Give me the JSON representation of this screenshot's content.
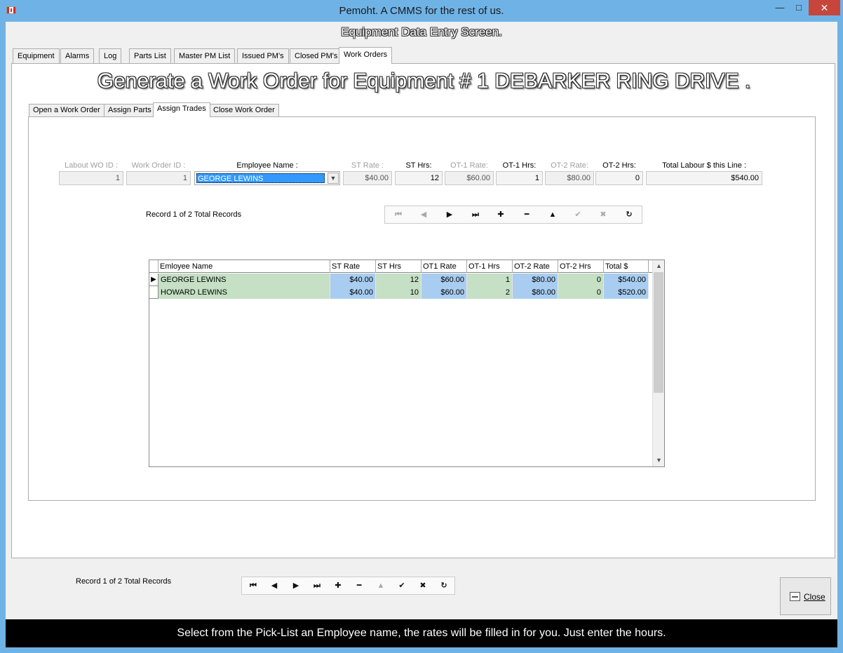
{
  "window": {
    "title": "Pemoht.  A CMMS for the rest of us.",
    "minimize": "—",
    "maximize": "□",
    "close": "✕"
  },
  "screen_title": "Equipment Data Entry Screen.",
  "tabs": [
    "Equipment",
    "Alarms",
    "Log",
    "Parts List",
    "Master PM List",
    "Issued PM's",
    "Closed PM's",
    "Work Orders"
  ],
  "active_tab": "Work Orders",
  "heading": "Generate a Work Order for Equipment # 1 DEBARKER RING DRIVE .",
  "inner_tabs": [
    "Open a Work Order",
    "Assign Parts",
    "Assign Trades",
    "Close Work Order"
  ],
  "active_inner_tab": "Assign Trades",
  "form": {
    "labels": {
      "wo_id": "Labout WO ID :",
      "work_order_id": "Work Order ID :",
      "employee": "Employee Name :",
      "st_rate": "ST Rate :",
      "st_hrs": "ST Hrs:",
      "ot1_rate": "OT-1 Rate:",
      "ot1_hrs": "OT-1 Hrs:",
      "ot2_rate": "OT-2 Rate:",
      "ot2_hrs": "OT-2 Hrs:",
      "total": "Total Labour $ this Line :"
    },
    "values": {
      "wo_id": "1",
      "work_order_id": "1",
      "employee": "GEORGE LEWINS",
      "st_rate": "$40.00",
      "st_hrs": "12",
      "ot1_rate": "$60.00",
      "ot1_hrs": "1",
      "ot2_rate": "$80.00",
      "ot2_hrs": "0",
      "total": "$540.00"
    }
  },
  "inner_record_label": "Record 1 of 2 Total Records",
  "outer_record_label": "Record 1 of 2 Total Records",
  "nav_icons": {
    "first": "⏮",
    "prev": "◀",
    "next": "▶",
    "last": "⏭",
    "add": "✚",
    "delete": "━",
    "edit": "▲",
    "save": "✔",
    "cancel": "✖",
    "refresh": "↻"
  },
  "grid": {
    "columns": [
      "Emloyee Name",
      "ST Rate",
      "ST Hrs",
      "OT1 Rate",
      "OT-1 Hrs",
      "OT-2 Rate",
      "OT-2 Hrs",
      "Total $"
    ],
    "rows": [
      [
        "GEORGE LEWINS",
        "$40.00",
        "12",
        "$60.00",
        "1",
        "$80.00",
        "0",
        "$540.00"
      ],
      [
        "HOWARD LEWINS",
        "$40.00",
        "10",
        "$60.00",
        "2",
        "$80.00",
        "0",
        "$520.00"
      ]
    ],
    "current_row_marker": "▶",
    "scroll_up": "▲",
    "scroll_down": "▼"
  },
  "close_button": "Close",
  "hint": "Select from the Pick-List an Employee name,  the rates will be filled in for you.  Just enter the hours.",
  "colors": {
    "frame": "#6fb3e6",
    "grid_green": "#c5e0c5",
    "grid_blue": "#a8cdf0",
    "selection": "#3399ff"
  }
}
